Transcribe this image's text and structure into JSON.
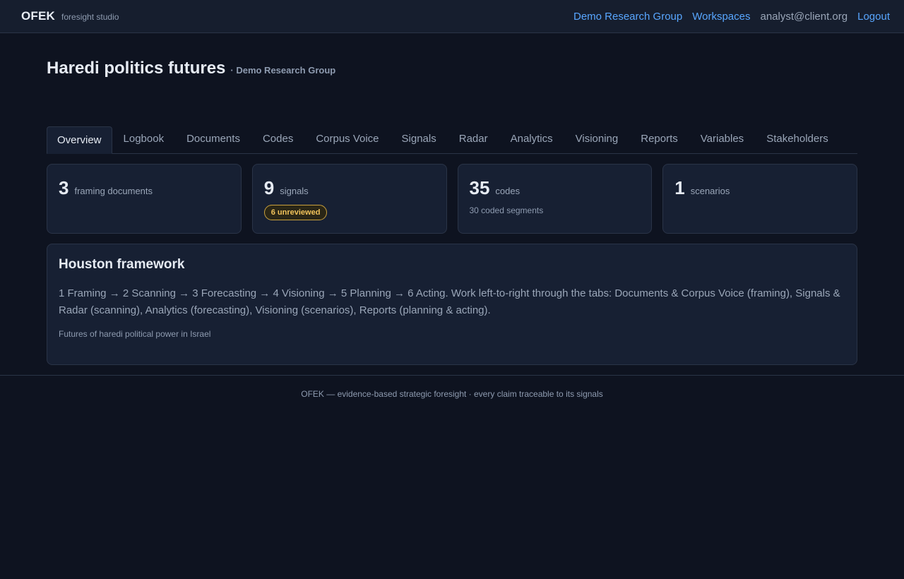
{
  "topbar": {
    "brand": "OFEK",
    "tagline": "foresight studio",
    "nav": {
      "group": "Demo Research Group",
      "workspaces": "Workspaces",
      "user": "analyst@client.org",
      "logout": "Logout"
    }
  },
  "page": {
    "title": "Haredi politics futures",
    "subtitle": "· Demo Research Group"
  },
  "tabs": [
    {
      "label": "Overview",
      "active": true
    },
    {
      "label": "Logbook"
    },
    {
      "label": "Documents"
    },
    {
      "label": "Codes"
    },
    {
      "label": "Corpus Voice"
    },
    {
      "label": "Signals"
    },
    {
      "label": "Radar"
    },
    {
      "label": "Analytics"
    },
    {
      "label": "Visioning"
    },
    {
      "label": "Reports"
    },
    {
      "label": "Variables"
    },
    {
      "label": "Stakeholders"
    }
  ],
  "stats": {
    "documents": {
      "value": "3",
      "label": "framing documents"
    },
    "signals": {
      "value": "9",
      "label": "signals",
      "badge": "6 unreviewed"
    },
    "codes": {
      "value": "35",
      "label": "codes",
      "extra": "30 coded segments"
    },
    "scenarios": {
      "value": "1",
      "label": "scenarios"
    }
  },
  "framework": {
    "title": "Houston framework",
    "body": "1 Framing → 2 Scanning → 3 Forecasting → 4 Visioning → 5 Planning → 6 Acting. Work left-to-right through the tabs: Documents & Corpus Voice (framing), Signals & Radar (scanning), Analytics (forecasting), Visioning (scenarios), Reports (planning & acting).",
    "note": "Futures of haredi political power in Israel"
  },
  "footer": {
    "text": "OFEK — evidence-based strategic foresight · every claim traceable to its signals"
  },
  "colors": {
    "background": "#0e1320",
    "panel": "#172033",
    "link": "#58a6ff",
    "badge": "#f2c35b"
  }
}
